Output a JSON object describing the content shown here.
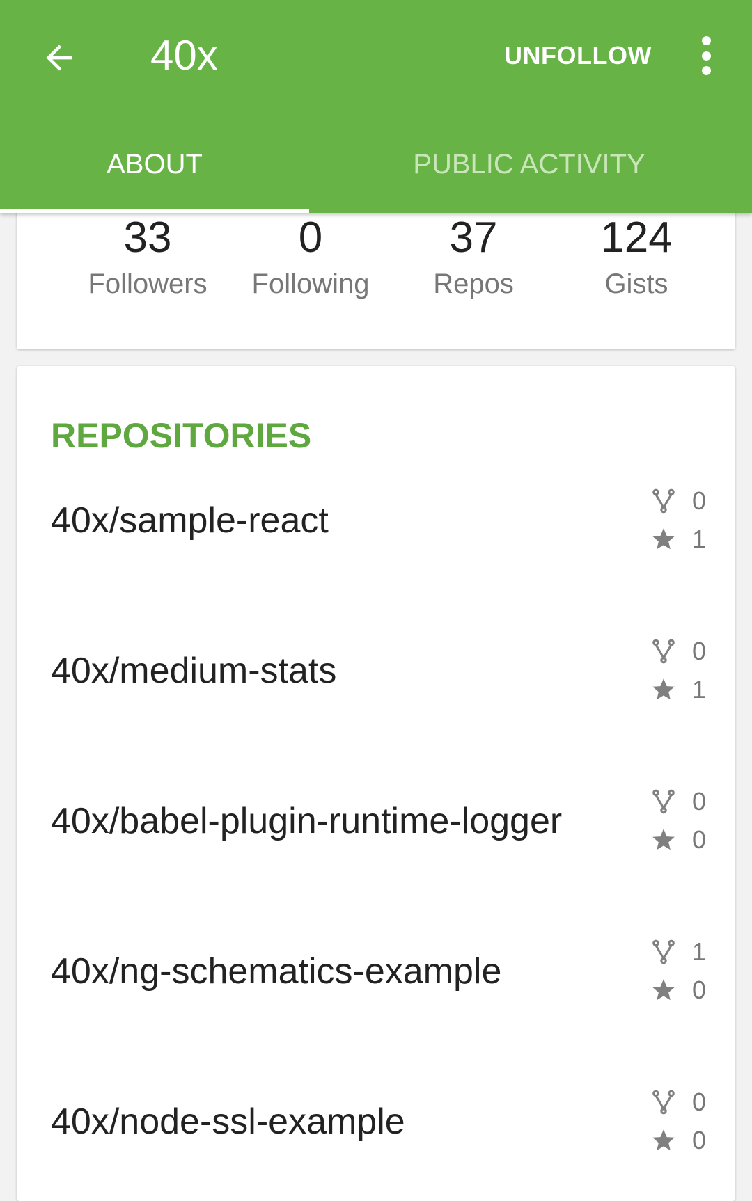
{
  "appbar": {
    "title": "40x",
    "unfollow_label": "UNFOLLOW",
    "background_color": "#67b346",
    "icons": [
      "back-arrow-icon",
      "more-vert-icon"
    ]
  },
  "tabs": [
    {
      "label": "ABOUT",
      "selected": true
    },
    {
      "label": "PUBLIC ACTIVITY",
      "selected": false
    }
  ],
  "stats": [
    {
      "value": "33",
      "label": "Followers"
    },
    {
      "value": "0",
      "label": "Following"
    },
    {
      "value": "37",
      "label": "Repos"
    },
    {
      "value": "124",
      "label": "Gists"
    }
  ],
  "repositories": {
    "title": "REPOSITORIES",
    "accent_color": "#5fa83f",
    "items": [
      {
        "name": "40x/sample-react",
        "forks": "0",
        "stars": "1"
      },
      {
        "name": "40x/medium-stats",
        "forks": "0",
        "stars": "1"
      },
      {
        "name": "40x/babel-plugin-runtime-logger",
        "forks": "0",
        "stars": "0"
      },
      {
        "name": "40x/ng-schematics-example",
        "forks": "1",
        "stars": "0"
      },
      {
        "name": "40x/node-ssl-example",
        "forks": "0",
        "stars": "0"
      }
    ]
  }
}
